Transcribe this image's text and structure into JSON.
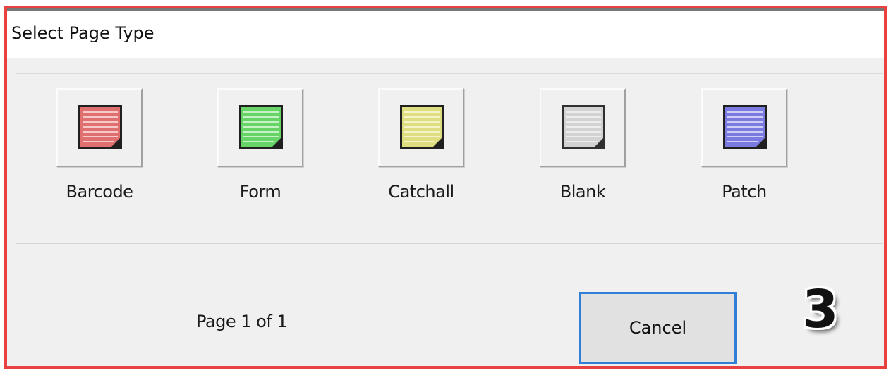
{
  "dialog": {
    "title": "Select Page Type",
    "page_types": [
      {
        "label": "Barcode",
        "icon": "barcode-page-icon",
        "color": "#e07070"
      },
      {
        "label": "Form",
        "icon": "form-page-icon",
        "color": "#66d466"
      },
      {
        "label": "Catchall",
        "icon": "catchall-page-icon",
        "color": "#dede80"
      },
      {
        "label": "Blank",
        "icon": "blank-page-icon",
        "color": "#d2d2d2"
      },
      {
        "label": "Patch",
        "icon": "patch-page-icon",
        "color": "#7a7ae0"
      }
    ],
    "page_info": "Page 1 of 1",
    "cancel_label": "Cancel"
  },
  "annotation": {
    "step_number": "3"
  },
  "colors": {
    "frame_border": "#e8413f",
    "button_focus": "#2f7fd6"
  }
}
